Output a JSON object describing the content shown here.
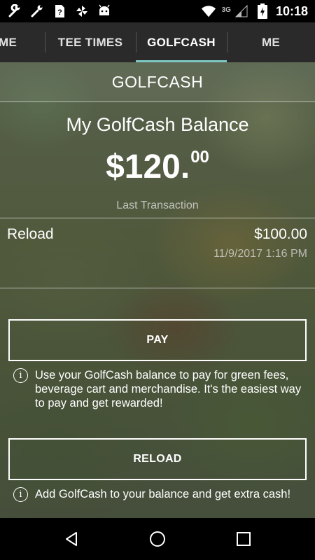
{
  "status_bar": {
    "time": "10:18",
    "network": "3G",
    "left_icons": [
      "wrench-icon",
      "wrench-icon",
      "sim-unknown-icon",
      "pinwheel-icon",
      "android-icon"
    ],
    "right_icons": [
      "wifi-icon",
      "cell-signal-icon",
      "battery-charging-icon"
    ]
  },
  "tabs": [
    {
      "label": "ME",
      "partial": true
    },
    {
      "label": "TEE TIMES"
    },
    {
      "label": "GOLFCASH",
      "active": true
    },
    {
      "label": "ME"
    }
  ],
  "section_title": "GOLFCASH",
  "balance": {
    "heading": "My GolfCash Balance",
    "dollars": "$120.",
    "cents": "00"
  },
  "last_transaction": {
    "label": "Last Transaction",
    "type": "Reload",
    "amount": "$100.00",
    "date": "11/9/2017 1:16 PM"
  },
  "pay": {
    "button_label": "PAY",
    "info": "Use your GolfCash balance to pay for green fees, beverage cart and merchandise. It's the easiest way to pay and get rewarded!"
  },
  "reload": {
    "button_label": "RELOAD",
    "info": "Add GolfCash to your balance and get extra cash!"
  },
  "nav_bar": [
    "back-icon",
    "home-icon",
    "recents-icon"
  ],
  "colors": {
    "tab_indicator": "#7fc8c4",
    "tab_bar_bg": "#2a2a2a"
  }
}
